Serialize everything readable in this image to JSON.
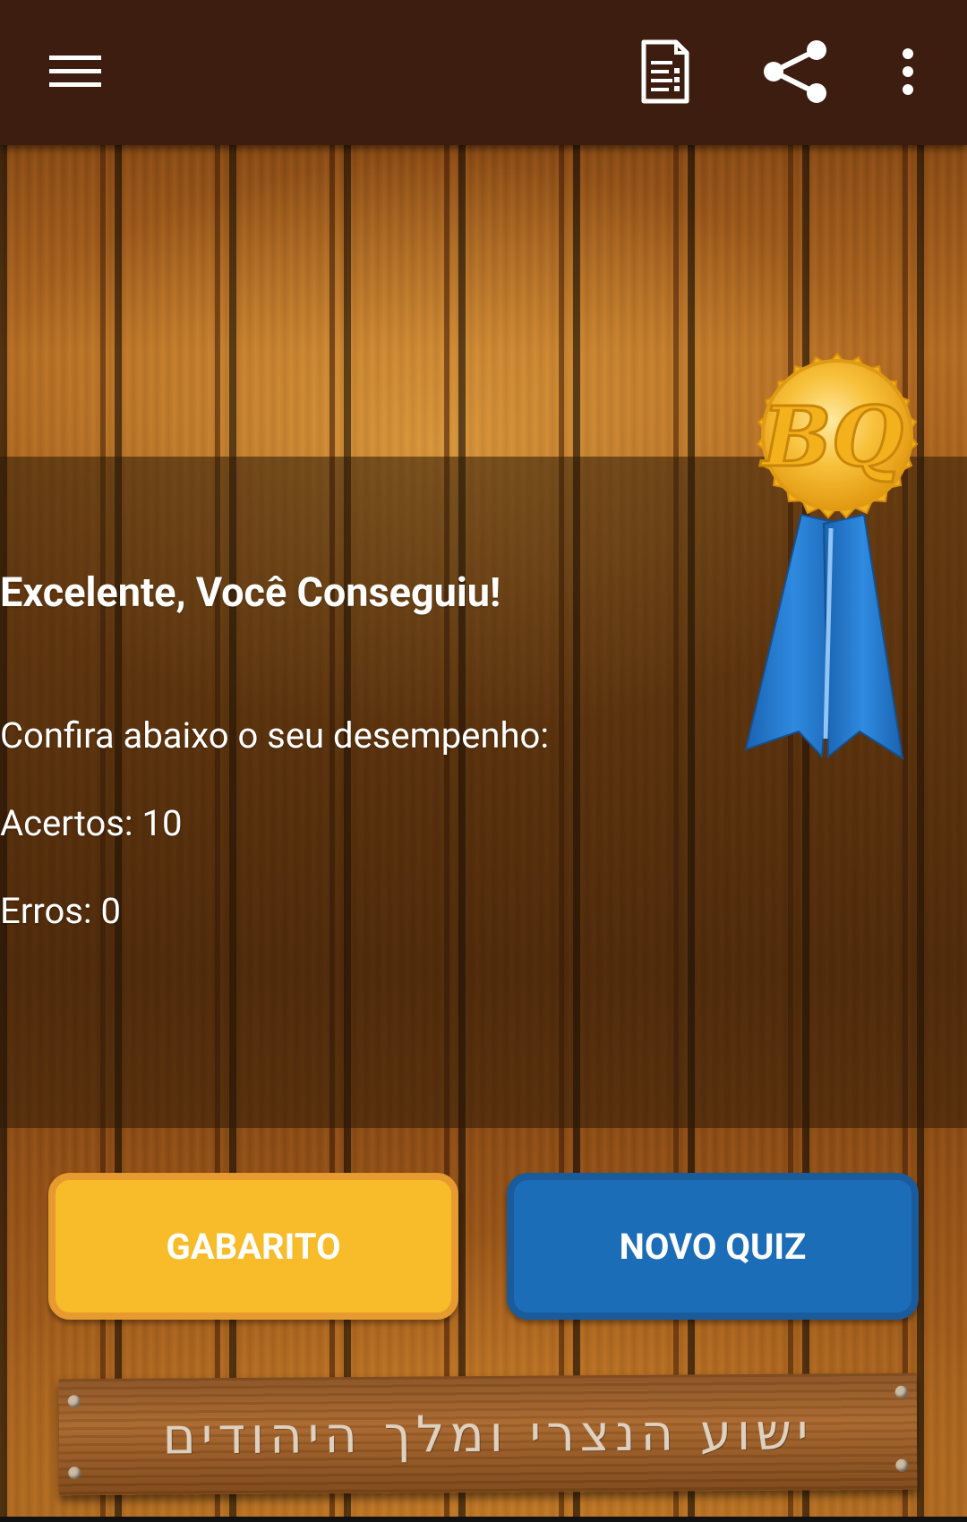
{
  "appbar": {
    "menu_icon": "hamburger-menu-icon",
    "answers_icon": "answer-sheet-icon",
    "share_icon": "share-icon",
    "overflow_icon": "more-vertical-icon"
  },
  "result": {
    "title": "Excelente, Você Conseguiu!",
    "subtitle": "Confira abaixo o seu desempenho:",
    "correct": "Acertos: 10",
    "errors": "Erros: 0"
  },
  "medal": {
    "label": "BQ"
  },
  "buttons": {
    "gabarito": "GABARITO",
    "novo_quiz": "NOVO QUIZ"
  },
  "sign": {
    "text": "ישוע הנצרי ומלך היהודים"
  },
  "colors": {
    "appbar": "#3c1d10",
    "gabarito_bg": "#f8bc2a",
    "novo_quiz_bg": "#1c6db7",
    "medal_gold": "#f5b82e",
    "ribbon_blue": "#1f77c9"
  }
}
